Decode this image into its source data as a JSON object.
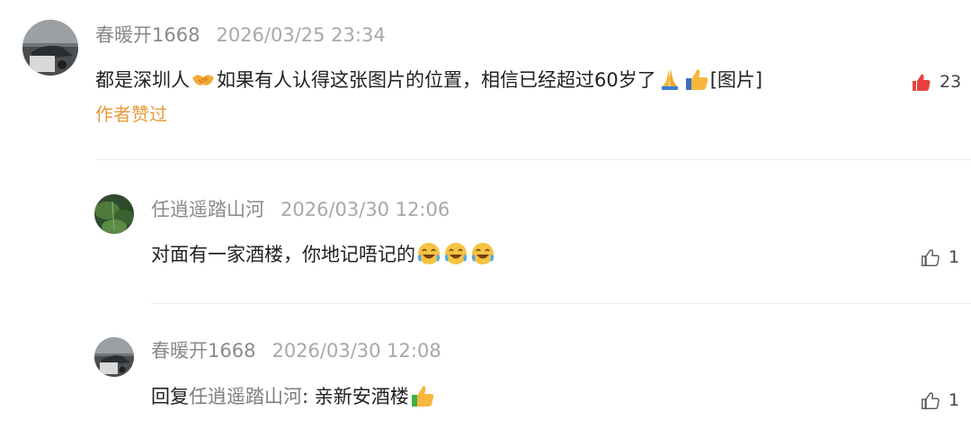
{
  "comments": [
    {
      "author": "春暖开1668",
      "time": "2026/03/25 23:34",
      "text_a": "都是深圳人",
      "text_b": "如果有人认得这张图片的位置，相信已经超过60岁了",
      "text_c": "[图片]",
      "emoji_a": "handshake-emoji",
      "emoji_b": "folded-hands-emoji",
      "emoji_c": "thumbs-up-emoji",
      "author_liked": "作者赞过",
      "likes": "23",
      "like_icon": "thumbs-up-filled-red-icon",
      "like_color": "#e8413c"
    },
    {
      "author": "任逍遥踏山河",
      "time": "2026/03/30 12:06",
      "text": "对面有一家酒楼，你地记唔记的",
      "emoji": [
        "laughing-crying-emoji",
        "laughing-crying-emoji",
        "laughing-crying-emoji"
      ],
      "likes": "1",
      "like_icon": "thumbs-up-outline-icon"
    },
    {
      "author": "春暖开1668",
      "time": "2026/03/30 12:08",
      "reply_prefix": "回复",
      "reply_target": "任逍遥踏山河",
      "reply_text": ": 亲新安酒楼",
      "emoji": "thumbs-up-emoji",
      "likes": "1",
      "like_icon": "thumbs-up-outline-icon"
    }
  ],
  "colors": {
    "author_gray": "#8a8a8a",
    "time_gray": "#a8a8a8",
    "author_liked_orange": "#e99a3a",
    "divider": "#ebebeb"
  }
}
